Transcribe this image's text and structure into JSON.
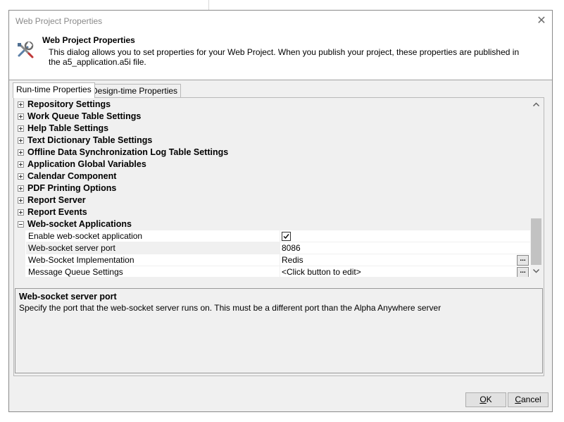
{
  "window": {
    "title": "Web Project Properties",
    "close_glyph": "✕"
  },
  "header": {
    "icon": "tools-icon",
    "title": "Web Project Properties",
    "description": "This dialog allows you to set properties for your Web Project. When you publish your project, these properties are published in the a5_application.a5i file."
  },
  "tabs": [
    {
      "label": "Run-time Properties",
      "active": true
    },
    {
      "label": "Design-time Properties",
      "active": false
    }
  ],
  "grid": {
    "categories": [
      {
        "label": "Repository Settings",
        "expanded": false
      },
      {
        "label": "Work Queue Table Settings",
        "expanded": false
      },
      {
        "label": "Help Table Settings",
        "expanded": false
      },
      {
        "label": "Text Dictionary Table Settings",
        "expanded": false
      },
      {
        "label": "Offline Data Synchronization Log Table Settings",
        "expanded": false
      },
      {
        "label": "Application Global Variables",
        "expanded": false
      },
      {
        "label": "Calendar Component",
        "expanded": false
      },
      {
        "label": "PDF Printing Options",
        "expanded": false
      },
      {
        "label": "Report Server",
        "expanded": false
      },
      {
        "label": "Report Events",
        "expanded": false
      },
      {
        "label": "Web-socket Applications",
        "expanded": true
      }
    ],
    "properties": [
      {
        "name": "Enable web-socket application",
        "value": "",
        "checked": true
      },
      {
        "name": "Web-socket server port",
        "value": "8086",
        "selected": true
      },
      {
        "name": "Web-Socket Implementation",
        "value": "Redis",
        "has_button": true
      },
      {
        "name": "Message Queue Settings",
        "value": "<Click button to edit>",
        "has_button": true
      }
    ],
    "ellipsis_label": "..."
  },
  "description_panel": {
    "title": "Web-socket server port",
    "text": "Specify the port that the web-socket server runs on. This must be a different port than the Alpha Anywhere server"
  },
  "buttons": {
    "ok": {
      "mnemonic": "O",
      "rest": "K"
    },
    "cancel": {
      "mnemonic": "C",
      "rest": "ancel"
    }
  },
  "colors": {
    "dialog_bg": "#f0f0f0",
    "grid_bg": "#ffffff",
    "title_text": "#8a8a8a"
  }
}
